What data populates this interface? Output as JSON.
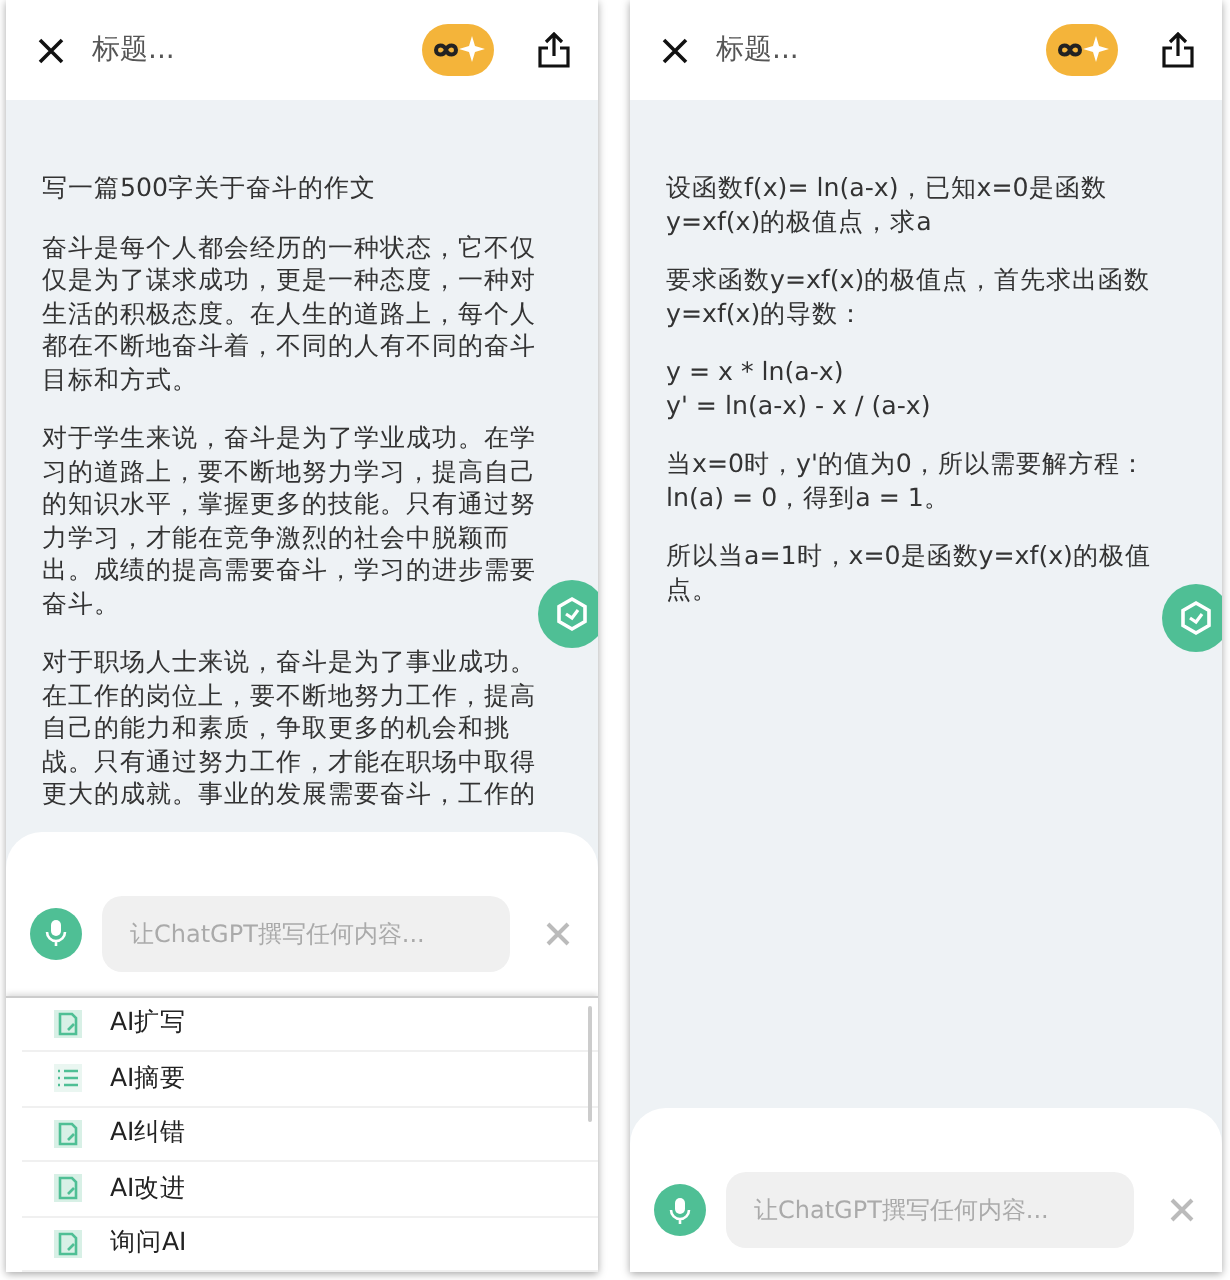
{
  "screens": [
    {
      "header": {
        "title_placeholder": "标题..."
      },
      "paragraphs": [
        "写一篇500字关于奋斗的作文",
        "奋斗是每个人都会经历的一种状态，它不仅仅是为了谋求成功，更是一种态度，一种对生活的积极态度。在人生的道路上，每个人都在不断地奋斗着，不同的人有不同的奋斗目标和方式。",
        "对于学生来说，奋斗是为了学业成功。在学习的道路上，要不断地努力学习，提高自己的知识水平，掌握更多的技能。只有通过努力学习，才能在竞争激烈的社会中脱颖而出。成绩的提高需要奋斗，学习的进步需要奋斗。",
        "对于职场人士来说，奋斗是为了事业成功。在工作的岗位上，要不断地努力工作，提高自己的能力和素质，争取更多的机会和挑战。只有通过努力工作，才能在职场中取得更大的成就。事业的发展需要奋斗，工作的"
      ],
      "composer": {
        "placeholder": "让ChatGPT撰写任何内容..."
      },
      "menu": [
        {
          "label": "AI扩写",
          "kind": "doc"
        },
        {
          "label": "AI摘要",
          "kind": "list"
        },
        {
          "label": "AI纠错",
          "kind": "doc"
        },
        {
          "label": "AI改进",
          "kind": "doc"
        },
        {
          "label": "询问AI",
          "kind": "doc"
        }
      ]
    },
    {
      "header": {
        "title_placeholder": "标题..."
      },
      "paragraphs": [
        "设函数f(x)= ln(a-x)，已知x=0是函数y=xf(x)的极值点，求a",
        "要求函数y=xf(x)的极值点，首先求出函数y=xf(x)的导数：",
        "y = x * ln(a-x)\ny' = ln(a-x) - x / (a-x)",
        "当x=0时，y'的值为0，所以需要解方程：ln(a) = 0，得到a = 1。",
        "所以当a=1时，x=0是函数y=xf(x)的极值点。"
      ],
      "composer": {
        "placeholder": "让ChatGPT撰写任何内容..."
      }
    }
  ]
}
